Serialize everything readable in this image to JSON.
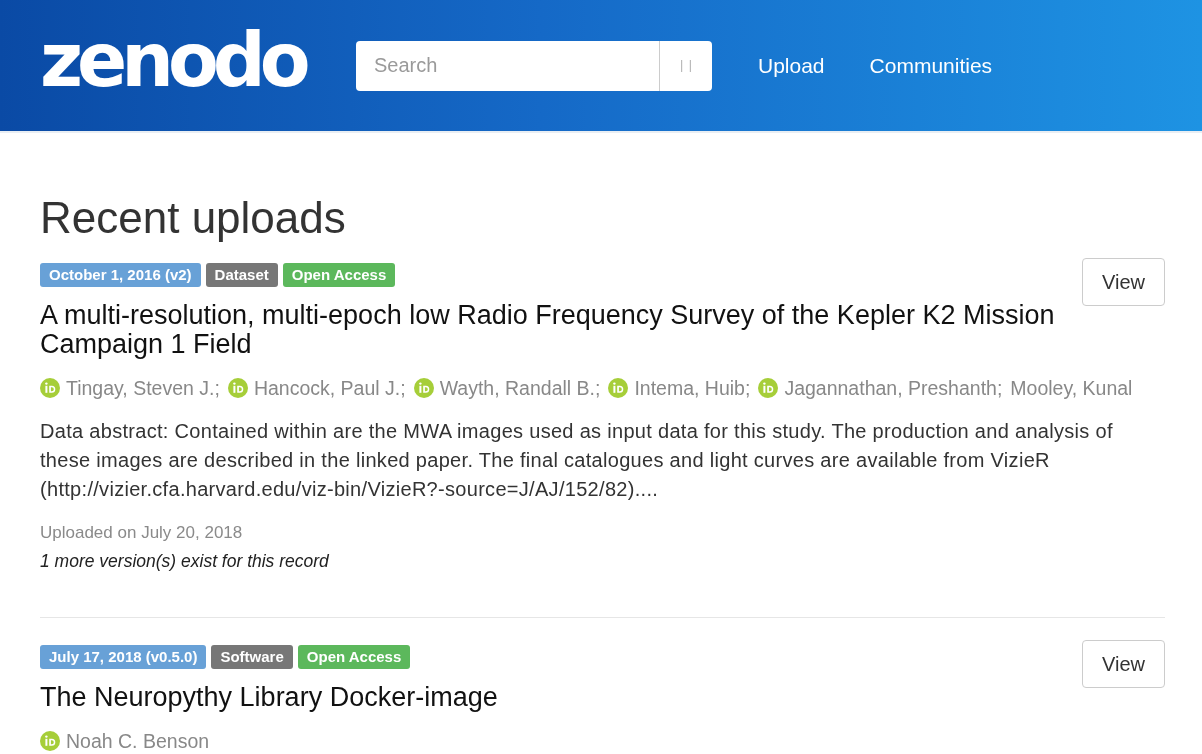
{
  "header": {
    "logo": "zenodo",
    "search": {
      "placeholder": "Search"
    },
    "nav": [
      "Upload",
      "Communities"
    ]
  },
  "main": {
    "heading": "Recent uploads",
    "records": [
      {
        "badges": [
          {
            "kind": "date",
            "text": "October 1, 2016 (v2)"
          },
          {
            "kind": "type",
            "text": "Dataset"
          },
          {
            "kind": "access",
            "text": "Open Access"
          }
        ],
        "title": "A multi-resolution, multi-epoch low Radio Frequency Survey of the Kepler K2 Mission Campaign 1 Field",
        "authors": [
          {
            "name": "Tingay, Steven J.;",
            "orcid": true
          },
          {
            "name": "Hancock, Paul J.;",
            "orcid": true
          },
          {
            "name": "Wayth, Randall B.;",
            "orcid": true
          },
          {
            "name": "Intema, Huib;",
            "orcid": true
          },
          {
            "name": "Jagannathan, Preshanth;",
            "orcid": true
          },
          {
            "name": "Mooley, Kunal",
            "orcid": false
          }
        ],
        "abstract": "Data abstract: Contained within are the MWA images used as input data for this study. The production and analysis of these images are described in the linked paper. The final catalogues and light curves are available from VizieR (http://vizier.cfa.harvard.edu/viz-bin/VizieR?-source=J/AJ/152/82)....",
        "uploaded": "Uploaded on July 20, 2018",
        "versions_note": "1 more version(s) exist for this record",
        "view_button": "View"
      },
      {
        "badges": [
          {
            "kind": "date",
            "text": "July 17, 2018 (v0.5.0)"
          },
          {
            "kind": "type",
            "text": "Software"
          },
          {
            "kind": "access",
            "text": "Open Access"
          }
        ],
        "title": "The Neuropythy Library Docker-image",
        "authors": [
          {
            "name": "Noah C. Benson",
            "orcid": true
          }
        ],
        "view_button": "View"
      }
    ]
  }
}
